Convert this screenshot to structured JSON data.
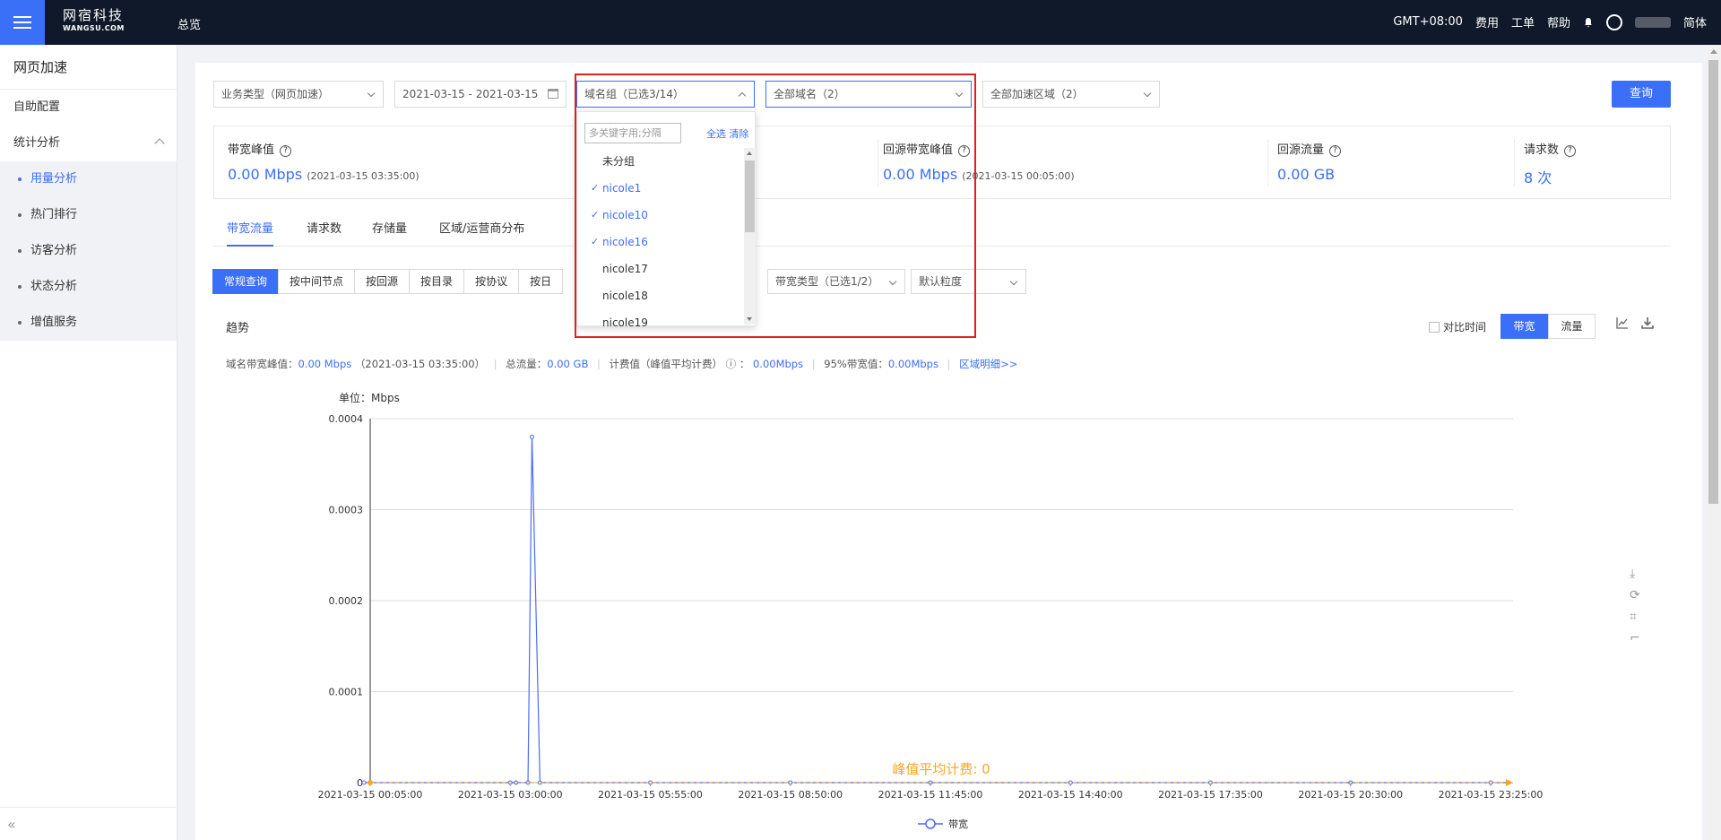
{
  "header": {
    "logo_cn": "网宿科技",
    "logo_en": "WANGSU.COM",
    "nav_overview": "总览",
    "timezone": "GMT+08:00",
    "links": [
      "费用",
      "工单",
      "帮助"
    ],
    "language": "简体"
  },
  "sidebar": {
    "title": "网页加速",
    "items": [
      {
        "label": "自助配置"
      },
      {
        "label": "统计分析"
      }
    ],
    "sub_items": [
      {
        "label": "用量分析",
        "active": true
      },
      {
        "label": "热门排行"
      },
      {
        "label": "访客分析"
      },
      {
        "label": "状态分析"
      },
      {
        "label": "增值服务"
      }
    ],
    "collapse_icon": "«"
  },
  "filters": {
    "business_type": "业务类型（网页加速）",
    "date_range": "2021-03-15 - 2021-03-15",
    "domain_group": "域名组（已选3/14）",
    "domain": "全部域名（2）",
    "region": "全部加速区域（2）",
    "query_button": "查询"
  },
  "stats": [
    {
      "label": "带宽峰值",
      "value": "0.00 Mbps",
      "note": "(2021-03-15 03:35:00)"
    },
    {
      "label": "回源带宽峰值",
      "value": "0.00 Mbps",
      "note": "(2021-03-15 00:05:00)"
    },
    {
      "label": "回源流量",
      "value": "0.00 GB",
      "note": ""
    },
    {
      "label": "请求数",
      "value": "8 次",
      "note": ""
    }
  ],
  "tabs": [
    "带宽流量",
    "请求数",
    "存储量",
    "区域/运营商分布"
  ],
  "query_modes": [
    "常规查询",
    "按中间节点",
    "按回源",
    "按目录",
    "按协议",
    "按日"
  ],
  "bandwidth_type": "带宽类型（已选1/2）",
  "granularity": "默认粒度",
  "trend": {
    "title": "趋势",
    "compare_label": "对比时间",
    "toggle": [
      "带宽",
      "流量"
    ]
  },
  "summary": {
    "peak_label": "域名带宽峰值：",
    "peak_value": "0.00 Mbps",
    "peak_time": "（2021-03-15 03:35:00）",
    "total_label": "总流量：",
    "total_value": "0.00 GB",
    "billing_label": "计费值（峰值平均计费）",
    "billing_value": "0.00Mbps",
    "p95_label": "95%带宽值：",
    "p95_value": "0.00Mbps",
    "region_link": "区域明细>>"
  },
  "dropdown": {
    "search_placeholder": "多关键字用;分隔",
    "select_all": "全选",
    "clear": "清除",
    "options": [
      {
        "label": "未分组",
        "selected": false
      },
      {
        "label": "nicole1",
        "selected": true
      },
      {
        "label": "nicole10",
        "selected": true
      },
      {
        "label": "nicole16",
        "selected": true
      },
      {
        "label": "nicole17",
        "selected": false
      },
      {
        "label": "nicole18",
        "selected": false
      },
      {
        "label": "nicole19",
        "selected": false
      }
    ]
  },
  "chart_data": {
    "type": "line",
    "unit_label": "单位：Mbps",
    "x_ticks": [
      "2021-03-15 00:05:00",
      "2021-03-15 03:00:00",
      "2021-03-15 05:55:00",
      "2021-03-15 08:50:00",
      "2021-03-15 11:45:00",
      "2021-03-15 14:40:00",
      "2021-03-15 17:35:00",
      "2021-03-15 20:30:00",
      "2021-03-15 23:25:00"
    ],
    "y_ticks": [
      "0.0004",
      "0.0003",
      "0.0002",
      "0.0001",
      "0"
    ],
    "ylim": [
      0,
      0.0004
    ],
    "x_range_hours": [
      0.0833,
      23.4167
    ],
    "series": [
      {
        "name": "带宽",
        "color": "#4a6cf7",
        "x_hours": [
          0.0833,
          3.25,
          3.5,
          3.5833,
          3.75,
          23.9167
        ],
        "y": [
          0,
          0,
          0,
          0.00038,
          0,
          0
        ]
      }
    ],
    "markline": {
      "label": "峰值平均计费: 0",
      "value": 0,
      "color": "#f5a623"
    },
    "grid": true,
    "legend": "bottom"
  },
  "colors": {
    "accent": "#3a6ff7",
    "topbar": "#0f1929",
    "highlight_box": "#e0201c"
  }
}
